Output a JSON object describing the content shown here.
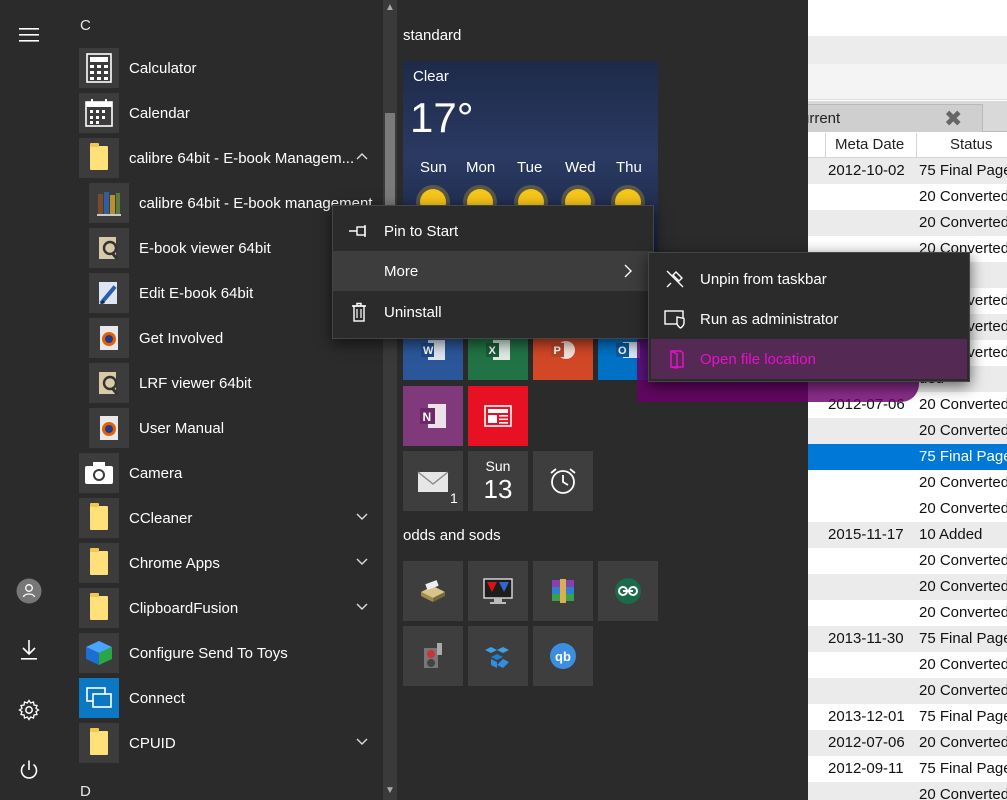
{
  "background_app": {
    "tab_label": "urrent",
    "tab_close": "✖",
    "columns": [
      "Meta Date",
      "Status"
    ],
    "rows": [
      {
        "date": "2012-10-02",
        "status": "75 Final Page"
      },
      {
        "date": "",
        "status": "20 Converted"
      },
      {
        "date": "",
        "status": "20 Converted"
      },
      {
        "date": "",
        "status": "20 Converted"
      },
      {
        "date": "",
        "status": "Page"
      },
      {
        "date": "",
        "status": "20 Converted"
      },
      {
        "date": "",
        "status": "20 Converted"
      },
      {
        "date": "",
        "status": "20 Converted"
      },
      {
        "date": "",
        "status": "ded"
      },
      {
        "date": "2012-07-06",
        "status": "20 Converted"
      },
      {
        "date": "",
        "status": "20 Converted"
      },
      {
        "date": "",
        "status": "75 Final Page"
      },
      {
        "date": "",
        "status": "20 Converted"
      },
      {
        "date": "",
        "status": "20 Converted"
      },
      {
        "date": "2015-11-17",
        "status": "10 Added"
      },
      {
        "date": "",
        "status": "20 Converted"
      },
      {
        "date": "",
        "status": "20 Converted"
      },
      {
        "date": "",
        "status": "20 Converted"
      },
      {
        "date": "2013-11-30",
        "status": "75 Final Page"
      },
      {
        "date": "",
        "status": "20 Converted"
      },
      {
        "date": "",
        "status": "20 Converted"
      },
      {
        "date": "2013-12-01",
        "status": "75 Final Page"
      },
      {
        "date": "2012-07-06",
        "status": "20 Converted"
      },
      {
        "date": "2012-09-11",
        "status": "75 Final Page"
      },
      {
        "date": "",
        "status": "20 Converted"
      }
    ]
  },
  "rail": {
    "menu_icon": "hamburger-icon",
    "user_icon": "user-icon",
    "downloads_icon": "download-icon",
    "settings_icon": "gear-icon",
    "power_icon": "power-icon"
  },
  "app_list": {
    "letter_c": "C",
    "letter_d": "D",
    "apps": [
      {
        "label": "Calculator",
        "icon": "calculator-icon"
      },
      {
        "label": "Calendar",
        "icon": "calendar-icon"
      },
      {
        "label": "calibre 64bit - E-book Managem...",
        "icon": "folder-icon",
        "expanded": true
      },
      {
        "label": "calibre 64bit - E-book management",
        "icon": "calibre-icon"
      },
      {
        "label": "E-book viewer 64bit",
        "icon": "ebook-viewer-icon"
      },
      {
        "label": "Edit E-book 64bit",
        "icon": "edit-ebook-icon"
      },
      {
        "label": "Get Involved",
        "icon": "firefox-icon"
      },
      {
        "label": "LRF viewer 64bit",
        "icon": "lrf-viewer-icon"
      },
      {
        "label": "User Manual",
        "icon": "firefox-icon"
      },
      {
        "label": "Camera",
        "icon": "camera-icon"
      },
      {
        "label": "CCleaner",
        "icon": "folder-icon"
      },
      {
        "label": "Chrome Apps",
        "icon": "folder-icon"
      },
      {
        "label": "ClipboardFusion",
        "icon": "folder-icon"
      },
      {
        "label": "Configure Send To Toys",
        "icon": "sendto-toys-icon"
      },
      {
        "label": "Connect",
        "icon": "connect-icon"
      },
      {
        "label": "CPUID",
        "icon": "folder-icon"
      }
    ]
  },
  "tiles": {
    "group1_title": "standard",
    "group2_title": "odds and sods",
    "weather": {
      "condition": "Clear",
      "temperature": "17°",
      "days": [
        "Sun",
        "Mon",
        "Tue",
        "Wed",
        "Thu"
      ]
    },
    "mail_count": "1",
    "calendar_day": "Sun",
    "calendar_date": "13",
    "colors": {
      "word": "#2b579a",
      "excel": "#217346",
      "powerpoint": "#d24726",
      "outlook": "#0072c6",
      "onenote": "#80397b",
      "news": "#e81123"
    }
  },
  "context_menu": {
    "items": [
      {
        "label": "Pin to Start",
        "icon": "pin-icon"
      },
      {
        "label": "More",
        "icon": ""
      },
      {
        "label": "Uninstall",
        "icon": "trash-icon"
      }
    ]
  },
  "submenu": {
    "items": [
      {
        "label": "Unpin from taskbar",
        "icon": "unpin-icon"
      },
      {
        "label": "Run as administrator",
        "icon": "shield-icon"
      },
      {
        "label": "Open file location",
        "icon": "folder-open-icon"
      }
    ],
    "highlight_color": "#d400d4"
  }
}
